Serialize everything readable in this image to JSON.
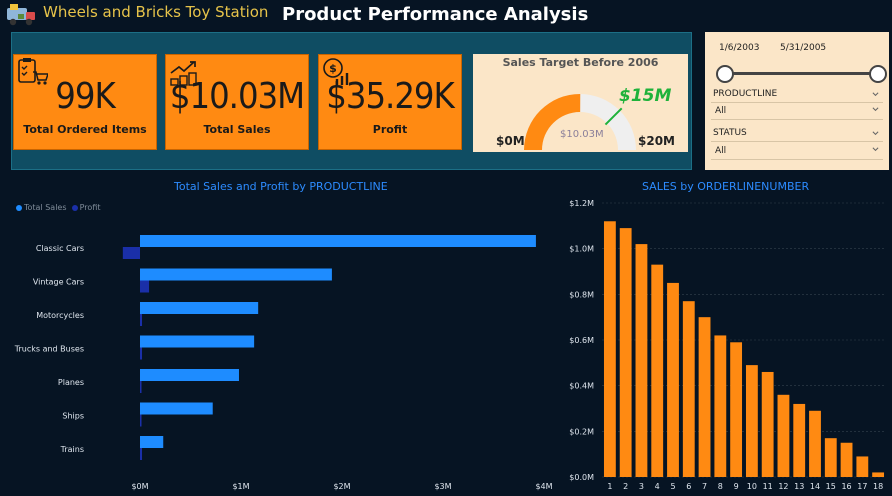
{
  "header": {
    "app_title": "Wheels and Bricks Toy Station",
    "page_title": "Product Performance Analysis"
  },
  "kpis": [
    {
      "value": "99K",
      "label": "Total Ordered Items",
      "icon": "clipboard-cart-icon"
    },
    {
      "value": "$10.03M",
      "label": "Total Sales",
      "icon": "money-growth-icon"
    },
    {
      "value": "$35.29K",
      "label": "Profit",
      "icon": "dollar-chart-icon"
    }
  ],
  "gauge": {
    "title": "Sales Target Before 2006",
    "min_label": "$0M",
    "max_label": "$20M",
    "value_label": "$10.03M",
    "target_label": "$15M",
    "value": 10.03,
    "max": 20,
    "target": 15
  },
  "filters": {
    "date_start": "1/6/2003",
    "date_end": "5/31/2005",
    "productline_label": "PRODUCTLINE",
    "productline_value": "All",
    "status_label": "STATUS",
    "status_value": "All"
  },
  "colors": {
    "orange": "#ff8a12",
    "sales_blue": "#1e8cff",
    "profit_blue": "#1a2fa8",
    "title_blue": "#2d8cff"
  },
  "chart_data": [
    {
      "type": "bar",
      "orientation": "horizontal",
      "title": "Total Sales and Profit by PRODUCTLINE",
      "legend": [
        "Total Sales",
        "Profit"
      ],
      "legend_position": "top-left",
      "categories": [
        "Classic Cars",
        "Vintage Cars",
        "Motorcycles",
        "Trucks and Buses",
        "Planes",
        "Ships",
        "Trains"
      ],
      "series": [
        {
          "name": "Total Sales",
          "values": [
            3.92,
            1.9,
            1.17,
            1.13,
            0.98,
            0.72,
            0.23
          ]
        },
        {
          "name": "Profit",
          "values": [
            -0.17,
            0.09,
            0.02,
            0.02,
            0.01,
            0.01,
            0.02
          ]
        }
      ],
      "x_ticks": [
        "$0M",
        "$1M",
        "$2M",
        "$3M",
        "$4M"
      ],
      "xlim": [
        0,
        4
      ]
    },
    {
      "type": "bar",
      "title": "SALES by ORDERLINENUMBER",
      "categories": [
        "1",
        "2",
        "3",
        "4",
        "5",
        "6",
        "7",
        "8",
        "9",
        "10",
        "11",
        "12",
        "13",
        "14",
        "15",
        "16",
        "17",
        "18"
      ],
      "values": [
        1.12,
        1.09,
        1.02,
        0.93,
        0.85,
        0.77,
        0.7,
        0.62,
        0.59,
        0.49,
        0.46,
        0.36,
        0.32,
        0.29,
        0.17,
        0.15,
        0.09,
        0.02
      ],
      "y_ticks": [
        "$0.0M",
        "$0.2M",
        "$0.4M",
        "$0.6M",
        "$0.8M",
        "$1.0M",
        "$1.2M"
      ],
      "ylim": [
        0,
        1.2
      ]
    }
  ]
}
